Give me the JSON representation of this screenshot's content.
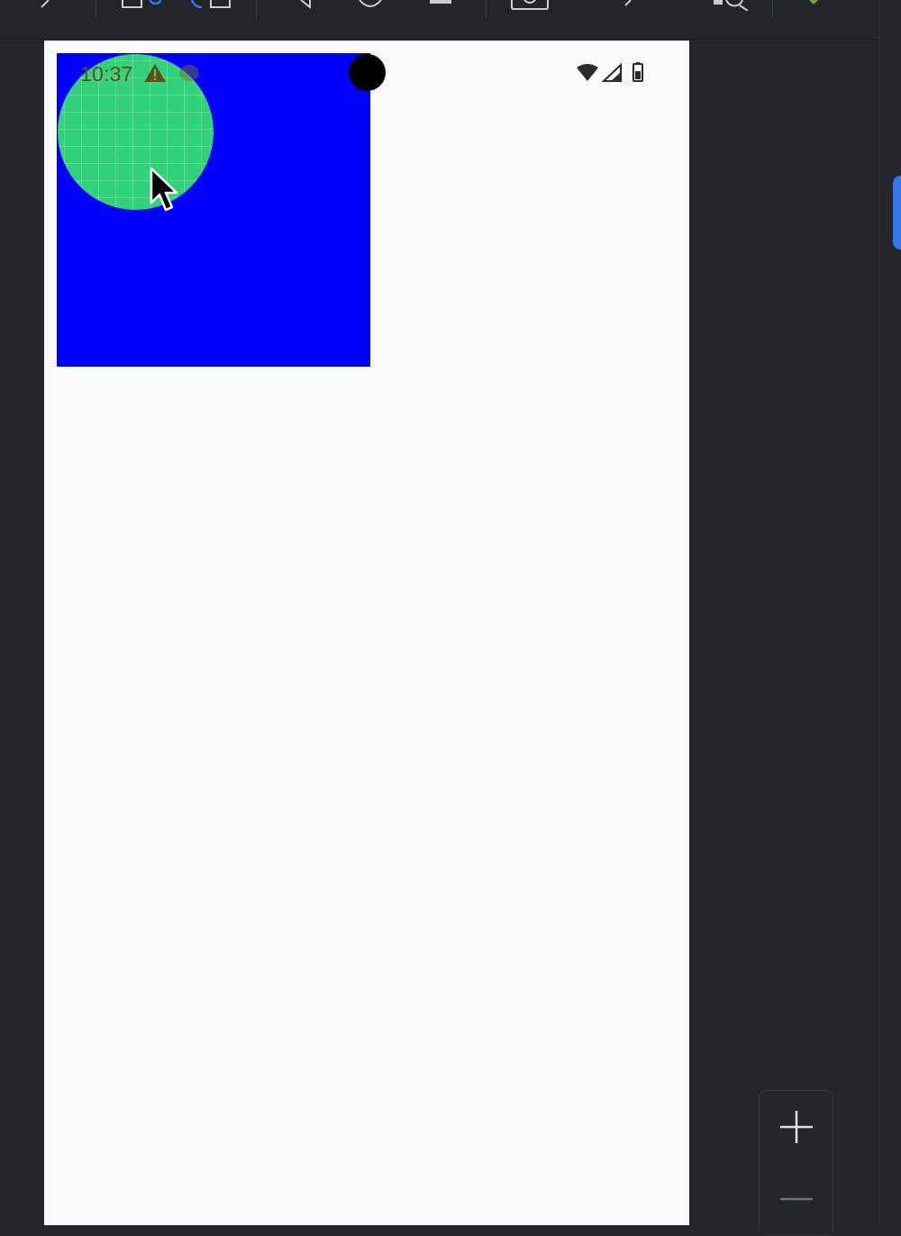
{
  "status_bar": {
    "time": "10:37",
    "icons": [
      "warning-icon",
      "wifi-icon",
      "cellular-signal-icon",
      "battery-icon"
    ]
  },
  "canvas": {
    "background_color": "#0000ff",
    "circle_color": "#33d17a"
  },
  "toolbar": {
    "buttons": [
      "back-icon",
      "rotate-left-icon",
      "rotate-right-icon",
      "volume-icon",
      "power-icon",
      "home-icon",
      "screenshot-icon",
      "undo-icon",
      "zoom-search-icon",
      "debug-icon"
    ]
  },
  "zoom_controls": {
    "zoom_in_label": "+",
    "zoom_out_label": "−"
  },
  "colors": {
    "ide_background": "#22252a",
    "device_background": "#f9fafc",
    "accent": "#3574f0"
  }
}
